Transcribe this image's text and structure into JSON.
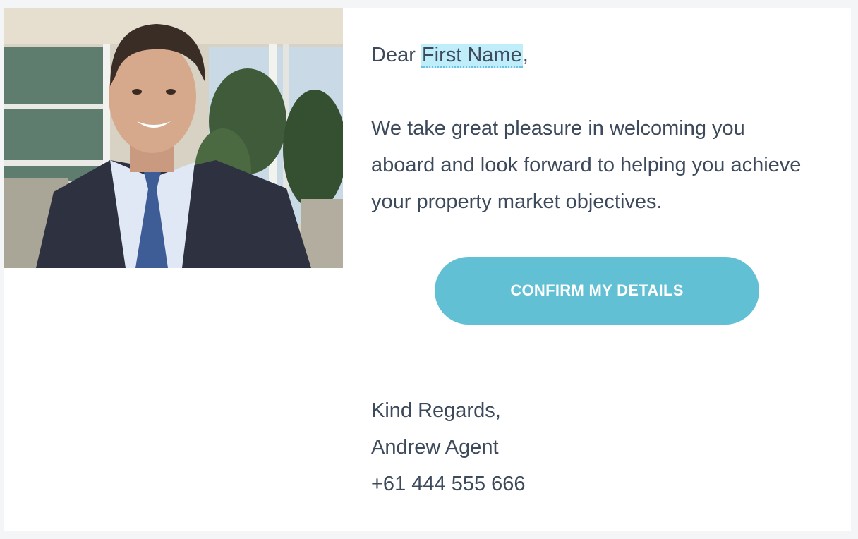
{
  "email": {
    "greeting_prefix": "Dear",
    "merge_tag": "First Name",
    "greeting_suffix": ",",
    "intro_text": "We take great pleasure in welcoming you aboard and look forward to helping you achieve your property market objectives.",
    "cta_label": "CONFIRM MY DETAILS",
    "signoff": "Kind Regards,",
    "agent_name": "Andrew Agent",
    "agent_phone": "+61 444 555 666"
  },
  "colors": {
    "background": "#f3f5f7",
    "card": "#ffffff",
    "text": "#3d4a5c",
    "cta": "#62c0d5",
    "merge_tag_highlight": "#bfeefa"
  }
}
